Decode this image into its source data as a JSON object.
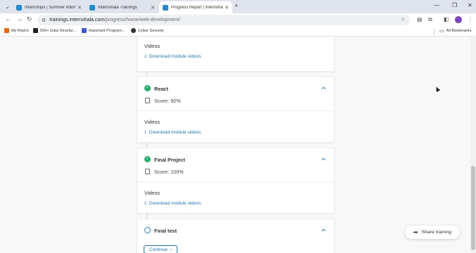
{
  "browser": {
    "tabs": [
      {
        "label": "Internships | Summer Internshi",
        "favicon_color": "#1a8cd8",
        "active": false
      },
      {
        "label": "Internshala Trainings",
        "favicon_color": "#1a8cd8",
        "active": false
      },
      {
        "label": "Progress Report | Internshala T",
        "favicon_color": "#1a8cd8",
        "active": true
      }
    ],
    "url_host": "trainings.internshala.com",
    "url_path": "/progress/home/web-development/",
    "bookmarks": [
      {
        "label": "My Repl.it",
        "icon_color": "#f26207"
      },
      {
        "label": "500+ Data Structur...",
        "icon_color": "#222222"
      },
      {
        "label": "Important Program...",
        "icon_color": "#3b5bdb"
      },
      {
        "label": "Cyber Security",
        "icon_color": "#333333"
      }
    ],
    "all_bookmarks_label": "All Bookmarks"
  },
  "modules": [
    {
      "title": "",
      "videos_label": "Videos",
      "download_label": "Download module videos"
    },
    {
      "title": "React",
      "status": "complete",
      "score": "Score: 90%",
      "videos_label": "Videos",
      "download_label": "Download module videos"
    },
    {
      "title": "Final Project",
      "status": "complete",
      "score": "Score: 100%",
      "videos_label": "Videos",
      "download_label": "Download module videos"
    },
    {
      "title": "Final test",
      "status": "pending",
      "continue_label": "Continue"
    }
  ],
  "share_label": "Share training",
  "colors": {
    "accent": "#1579c6",
    "success": "#1fb36b"
  }
}
